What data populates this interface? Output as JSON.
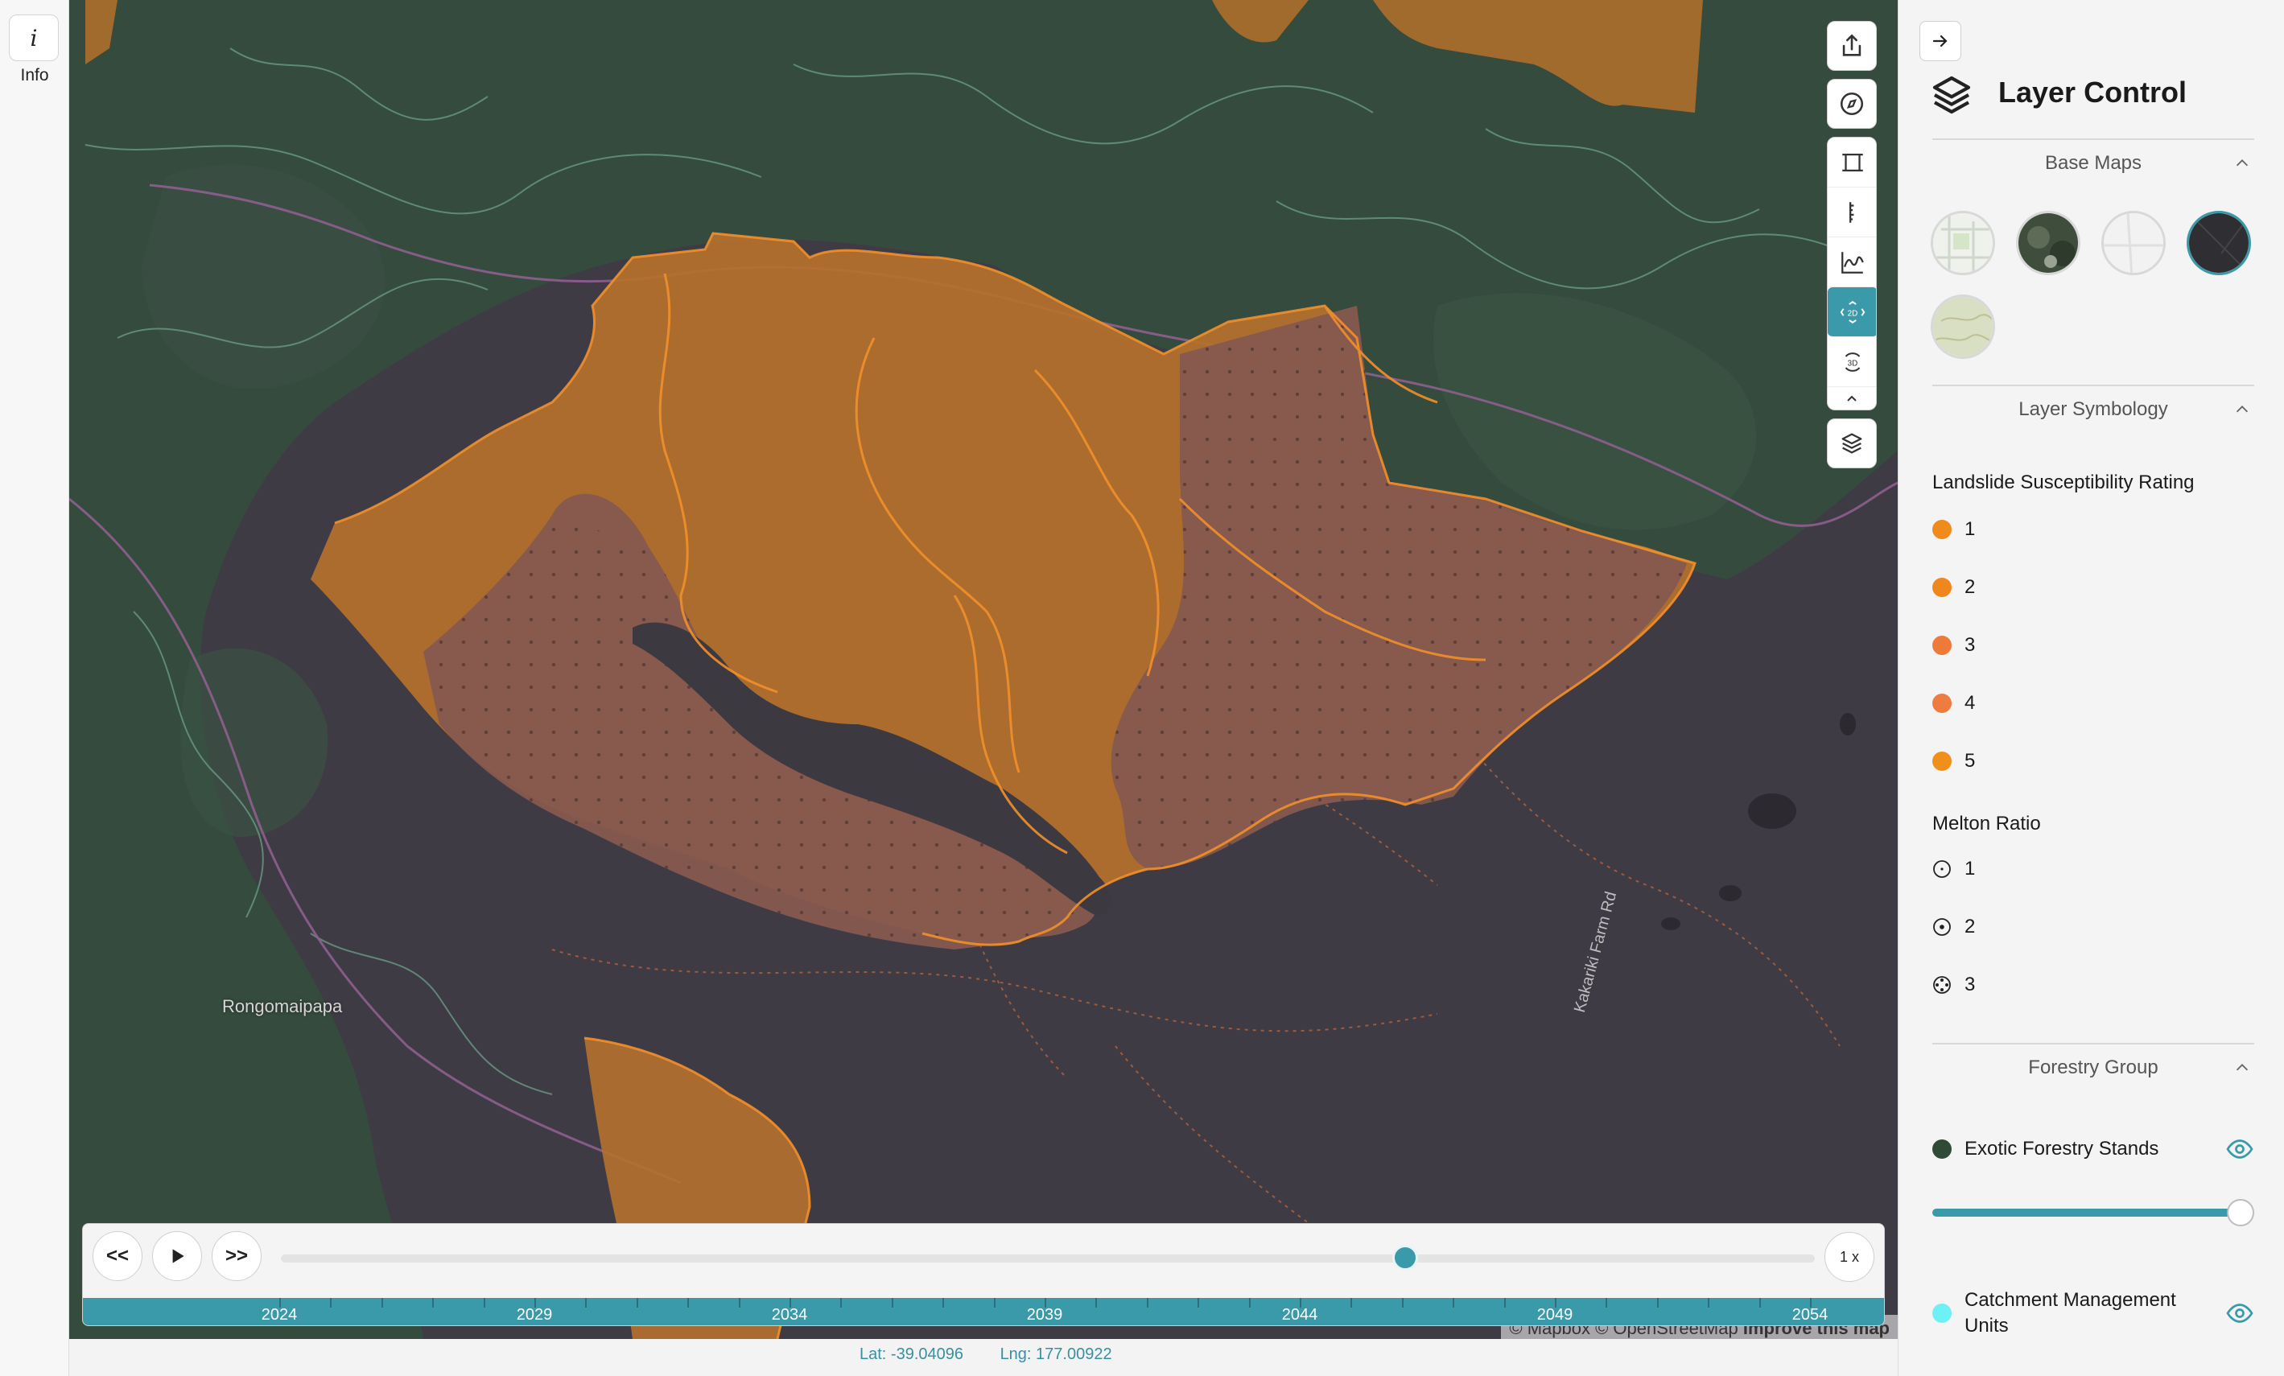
{
  "info": {
    "icon": "i",
    "label": "Info"
  },
  "map": {
    "place_label": "Rongomaipapa",
    "road_label": "Kakariki Farm Rd",
    "attribution_prefix": "© Mapbox © OpenStreetMap",
    "attribution_link": "Improve this map"
  },
  "tools": [
    {
      "name": "share-icon"
    },
    {
      "name": "compass-icon"
    },
    {
      "name": "frame-icon"
    },
    {
      "name": "ruler-icon"
    },
    {
      "name": "elevation-profile-icon"
    },
    {
      "name": "2d-view-icon",
      "label": "2D",
      "active": true
    },
    {
      "name": "3d-view-icon",
      "label": "3D"
    },
    {
      "name": "layers-icon"
    }
  ],
  "timeline": {
    "back_label": "<<",
    "forward_label": ">>",
    "speed_label": "1 x",
    "years": [
      "2024",
      "2029",
      "2034",
      "2039",
      "2044",
      "2049",
      "2054"
    ],
    "progress": 0.733
  },
  "coords": {
    "lat": "Lat: -39.04096",
    "lng": "Lng: 177.00922"
  },
  "panel": {
    "title": "Layer Control",
    "base_maps_label": "Base Maps",
    "symbology_label": "Layer Symbology",
    "landslide_heading": "Landslide Susceptibility Rating",
    "landslide_items": [
      {
        "label": "1",
        "color": "#f08a1a"
      },
      {
        "label": "2",
        "color": "#f0861e"
      },
      {
        "label": "3",
        "color": "#ee7a3a"
      },
      {
        "label": "4",
        "color": "#ee7c40"
      },
      {
        "label": "5",
        "color": "#f0901a"
      }
    ],
    "melton_heading": "Melton Ratio",
    "melton_items": [
      "1",
      "2",
      "3"
    ],
    "forestry_label": "Forestry Group",
    "layers": [
      {
        "label": "Exotic Forestry Stands",
        "color": "#2f4a36"
      },
      {
        "label": "Catchment Management Units",
        "color": "#6ff0f4"
      }
    ],
    "opacity": 1.0
  },
  "colors": {
    "accent": "#3a9aa9",
    "forest": "#344b3d",
    "hazard_orange": "#b5712c",
    "hazard_red": "#86584f"
  }
}
